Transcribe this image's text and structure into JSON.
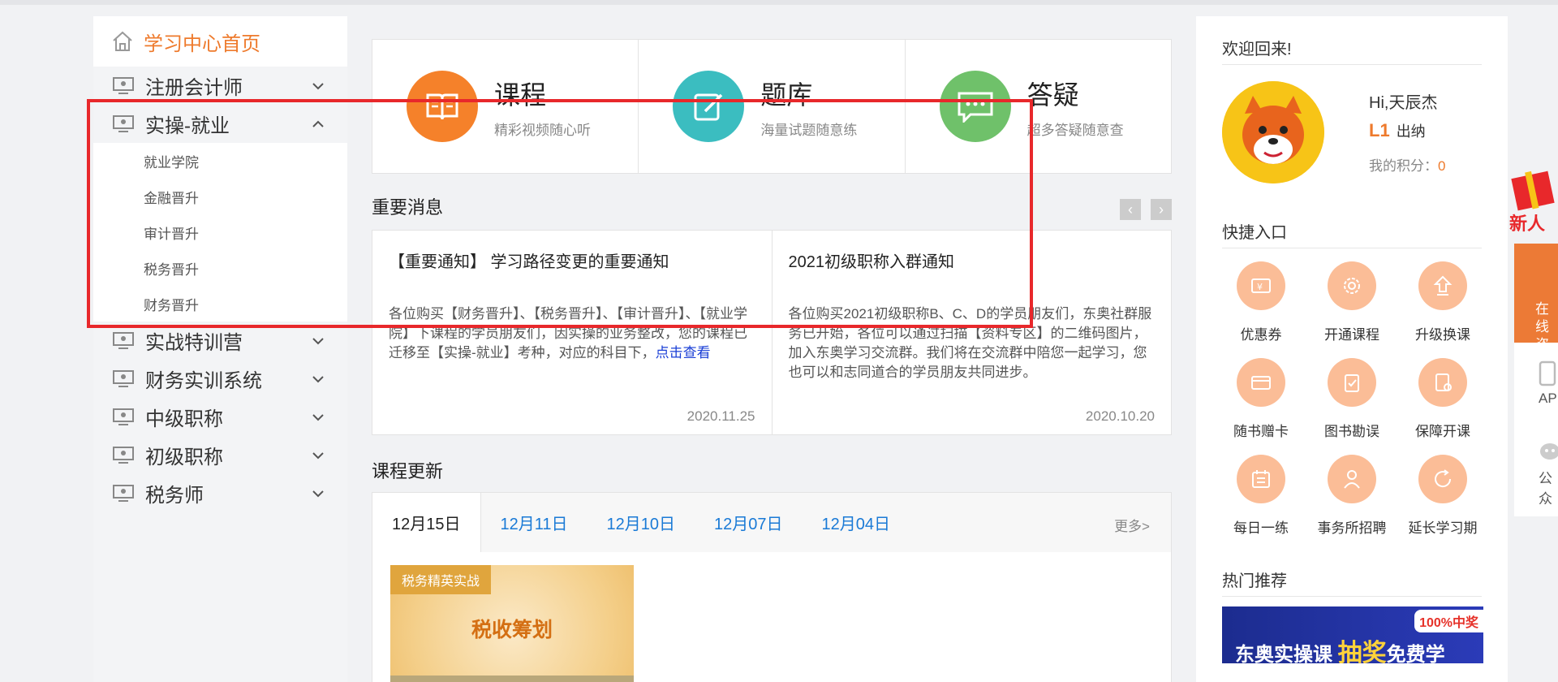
{
  "sidebar": {
    "home": "学习中心首页",
    "menu": [
      {
        "label": "注册会计师"
      },
      {
        "label": "实操-就业"
      },
      {
        "label": "实战特训营"
      },
      {
        "label": "财务实训系统"
      },
      {
        "label": "中级职称"
      },
      {
        "label": "初级职称"
      },
      {
        "label": "税务师"
      }
    ],
    "submenu": [
      "就业学院",
      "金融晋升",
      "审计晋升",
      "税务晋升",
      "财务晋升"
    ]
  },
  "features": [
    {
      "title": "课程",
      "subtitle": "精彩视频随心听",
      "color": "#f5812a"
    },
    {
      "title": "题库",
      "subtitle": "海量试题随意练",
      "color": "#3bbdc0"
    },
    {
      "title": "答疑",
      "subtitle": "超多答疑随意查",
      "color": "#6fc16a"
    }
  ],
  "news": {
    "title": "重要消息",
    "items": [
      {
        "title": "【重要通知】 学习路径变更的重要通知",
        "body": "各位购买【财务晋升】、【税务晋升】、【审计晋升】、【就业学院】下课程的学员朋友们，因实操的业务整改，您的课程已迁移至【实操-就业】考种，对应的科目下，",
        "link": "点击查看",
        "date": "2020.11.25"
      },
      {
        "title": "2021初级职称入群通知",
        "body": "各位购买2021初级职称B、C、D的学员朋友们，东奥社群服务已开始，各位可以通过扫描【资料专区】的二维码图片，加入东奥学习交流群。我们将在交流群中陪您一起学习，您也可以和志同道合的学员朋友共同进步。",
        "link": "",
        "date": "2020.10.20"
      }
    ]
  },
  "course_updates": {
    "title": "课程更新",
    "tabs": [
      "12月15日",
      "12月11日",
      "12月10日",
      "12月07日",
      "12月04日"
    ],
    "more": "更多>",
    "card": {
      "tag": "税务精英实战",
      "title": "税收筹划"
    }
  },
  "user": {
    "welcome": "欢迎回来!",
    "name": "Hi,天辰杰",
    "level_badge": "L1",
    "level_name": "出纳",
    "points_label": "我的积分：",
    "points": "0"
  },
  "quick": {
    "title": "快捷入口",
    "items": [
      "优惠券",
      "开通课程",
      "升级换课",
      "随书赠卡",
      "图书勘误",
      "保障开课",
      "每日一练",
      "事务所招聘",
      "延长学习期"
    ]
  },
  "hot": {
    "title": "热门推荐",
    "badge": "100%中奖",
    "text_a": "东奥实操课",
    "text_b": "抽奖",
    "text_c": "免费学"
  },
  "float": {
    "promo": "新人",
    "consult": "在线咨询",
    "app": "AP",
    "gzh": "公众"
  }
}
